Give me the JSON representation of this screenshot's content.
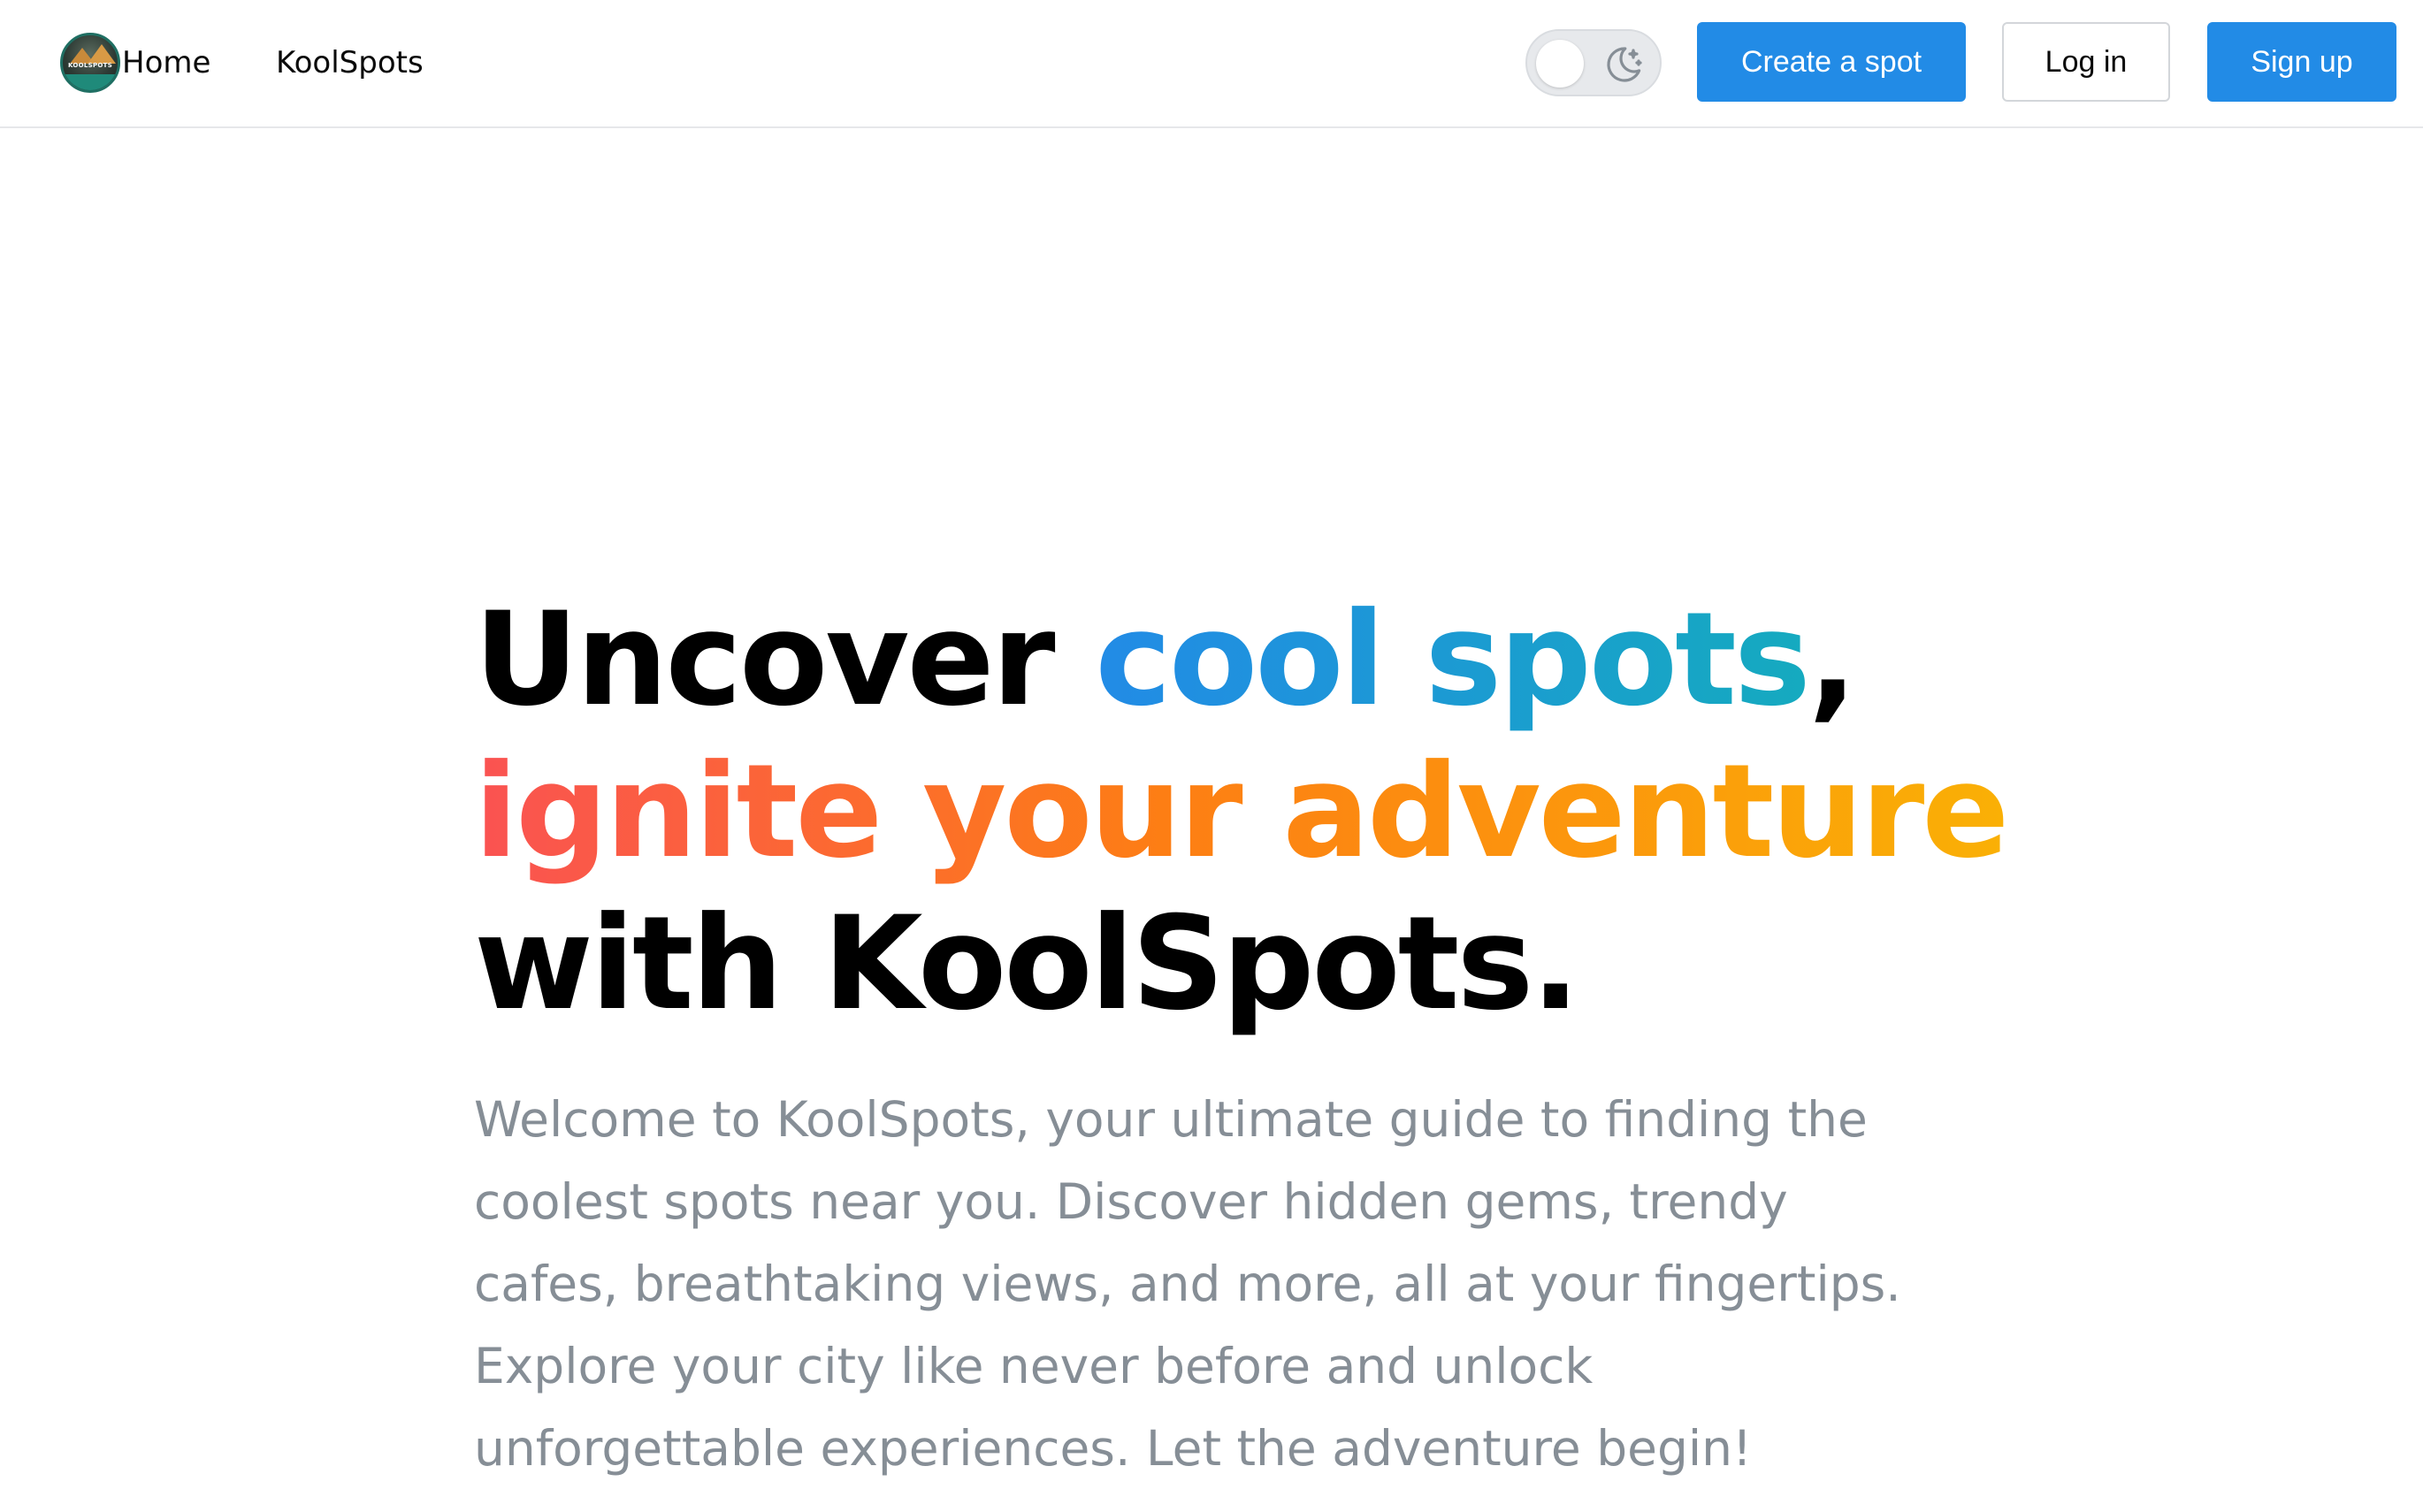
{
  "navbar": {
    "logo_text": "KOOLSPOTS",
    "links": [
      {
        "label": "Home"
      },
      {
        "label": "KoolSpots"
      }
    ],
    "theme_toggle": {
      "state": "light",
      "icon": "moon-stars-icon"
    },
    "buttons": {
      "create": "Create a spot",
      "login": "Log in",
      "signup": "Sign up"
    }
  },
  "hero": {
    "title": {
      "line1_part1": "Uncover ",
      "line1_highlight": "cool spots",
      "line1_part2": ",",
      "line2_highlight": "ignite your adventure",
      "line3": "with KoolSpots."
    },
    "description": "Welcome to KoolSpots, your ultimate guide to finding the coolest spots near you. Discover hidden gems, trendy cafes, breathtaking views, and more, all at your fingertips. Explore your city like never before and unlock unforgettable experiences. Let the adventure begin!"
  },
  "colors": {
    "primary": "#228be6",
    "gradient_blue": [
      "#228be6",
      "#15aabf"
    ],
    "gradient_orange": [
      "#fa5252",
      "#fd7e14",
      "#fab005"
    ],
    "description_text": "#868e96",
    "navbar_border": "#e6e7ea"
  }
}
